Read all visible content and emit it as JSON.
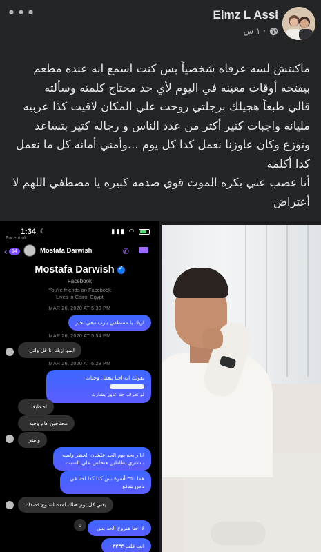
{
  "post": {
    "author": "Eimz L Assi",
    "time": "١ س ·",
    "text_lines": [
      "ماكنتش لسه عرفاه شخصياً بس كنت اسمع انه عنده مطعم",
      "بيفتحه أوقات معينه في اليوم لأي حد محتاج كلمته وسألته",
      "قالي طبعاً هجيلك برجلتي روحت علي المكان لاقيت كذا عربيه",
      "مليانه واجبات كتير أكتر من عدد الناس و رجاله كتير بتساعد",
      "وتوزع وكان عاوزنا نعمل كدا كل يوم ...وأمني أمانه كل ما نعمل",
      "كدا أكلمه",
      "أنا غصب عني بكره الموت قوي صدمه كبيره يا مصطفي اللهم لا",
      "أعتراض"
    ]
  },
  "screenshot": {
    "status_time": "1:34",
    "back_label": "Facebook",
    "unread_badge": "14",
    "contact_name": "Mostafa Darwish",
    "profile_name": "Mostafa Darwish",
    "profile_source": "Facebook",
    "profile_friends": "You're friends on Facebook",
    "profile_location": "Lives in Cairo, Egypt",
    "timestamps": [
      "MAR 26, 2020 AT 5:38 PM",
      "MAR 26, 2020 AT 5:54 PM",
      "MAR 26, 2020 AT 6:28 PM"
    ],
    "messages": [
      {
        "dir": "out",
        "text": "ازيك يا مصطفي يارب تبقي بخير"
      },
      {
        "dir": "in",
        "text": "ايمو ازيك انا قل واتي"
      },
      {
        "dir": "out",
        "text": "بقولك ايه احنا بنعمل وجبات"
      },
      {
        "dir": "out",
        "text": "لو تعرف حد عاوز يشارك"
      },
      {
        "dir": "in",
        "text": "اه طبعا"
      },
      {
        "dir": "in",
        "text": "محتاجين كام وجبه"
      },
      {
        "dir": "in",
        "text": "وامتي"
      },
      {
        "dir": "out",
        "text": "انا رايحه يوم الحد علشان الحظر ولسه"
      },
      {
        "dir": "out",
        "text": "بنشتري بطاطين هنخلص علي السبت"
      },
      {
        "dir": "out",
        "text": "هما ٣٥٠ أسرة بس كدا كدا احنا في"
      },
      {
        "dir": "out",
        "text": "ناس بتدفع"
      },
      {
        "dir": "in",
        "text": "يعني كل يوم هناك لمده اسبوع قصدك"
      },
      {
        "dir": "out",
        "text": "لا احنا هنروح الحد بس"
      },
      {
        "dir": "out",
        "text": "انت قلت ٣٣٣٣"
      }
    ]
  },
  "colors": {
    "post_bg": "#242526",
    "outgoing_bubble": "#4b63ff",
    "incoming_bubble": "#303030",
    "messenger_accent": "#9d6bff"
  }
}
